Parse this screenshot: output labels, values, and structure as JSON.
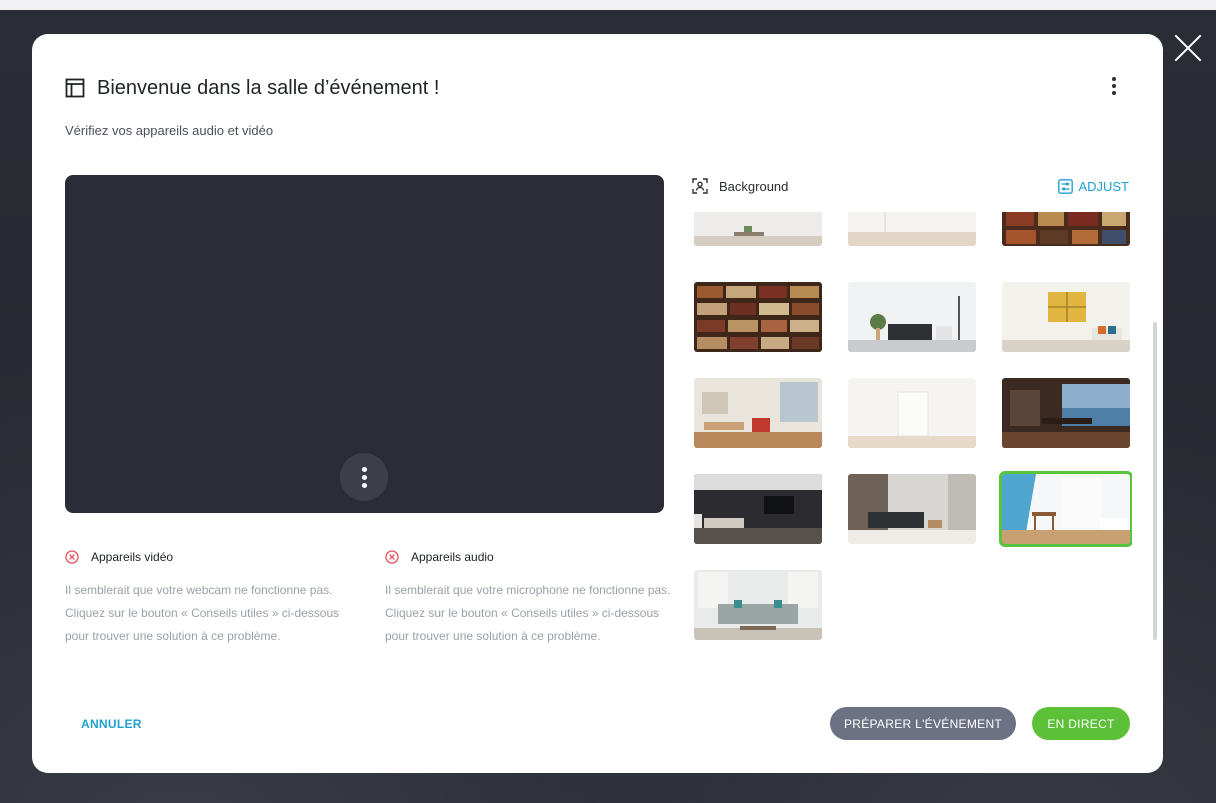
{
  "dialog": {
    "title": "Bienvenue dans la salle d’événement !",
    "subtitle": "Vérifiez vos appareils audio et vidéo"
  },
  "video_device": {
    "label": "Appareils vidéo",
    "message": "Il semblerait que votre webcam ne fonctionne pas. Cliquez sur le bouton « Conseils utiles » ci-dessous pour trouver une solution à ce problème."
  },
  "audio_device": {
    "label": "Appareils audio",
    "message": "Il semblerait que votre microphone ne fonctionne pas. Cliquez sur le bouton « Conseils utiles » ci-dessous pour trouver une solution à ce problème."
  },
  "background": {
    "title": "Background",
    "adjust_label": "ADJUST",
    "thumbnails": [
      {
        "name": "bg-white-shelf"
      },
      {
        "name": "bg-empty-white-room"
      },
      {
        "name": "bg-bookshelf-dark"
      },
      {
        "name": "bg-bookshelf-library"
      },
      {
        "name": "bg-white-living-room"
      },
      {
        "name": "bg-yellow-art-living-room"
      },
      {
        "name": "bg-loft-dining"
      },
      {
        "name": "bg-bright-empty-room"
      },
      {
        "name": "bg-sea-view-dining"
      },
      {
        "name": "bg-modern-lounge-tv"
      },
      {
        "name": "bg-grey-sofa-lounge"
      },
      {
        "name": "bg-bright-window-room",
        "selected": true
      },
      {
        "name": "bg-blue-sofa-room"
      }
    ]
  },
  "actions": {
    "cancel_label": "ANNULER",
    "prepare_label": "PRÉPARER L'ÉVÉNEMENT",
    "live_label": "EN DIRECT"
  },
  "colors": {
    "accent_blue": "#1fa0d1",
    "live_green": "#5cc139",
    "prepare_grey": "#6c7284",
    "error_red": "#e8505b",
    "preview_bg": "#2b2c37"
  }
}
